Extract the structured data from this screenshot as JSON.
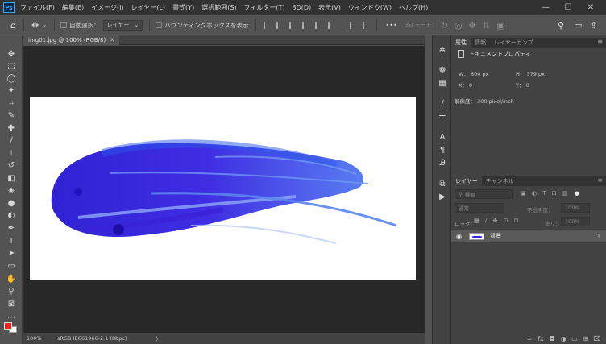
{
  "app": {
    "logo": "Ps"
  },
  "menu": [
    "ファイル(F)",
    "編集(E)",
    "イメージ(I)",
    "レイヤー(L)",
    "書式(Y)",
    "選択範囲(S)",
    "フィルター(T)",
    "3D(D)",
    "表示(V)",
    "ウィンドウ(W)",
    "ヘルプ(H)"
  ],
  "window_controls": {
    "minimize": "—",
    "maximize": "☐",
    "close": "✕"
  },
  "options": {
    "auto_select_label": "自動選択：",
    "auto_select_value": "レイヤー",
    "bounding_box_label": "バウンディングボックスを表示",
    "more": "•••",
    "mode_3d": "3D モード："
  },
  "top_right": {
    "search": "⚲",
    "workspace": "▭",
    "share": "⇪"
  },
  "document": {
    "tab_label": "img01.jpg @ 100% (RGB/8)",
    "tab_close": "✕",
    "zoom": "100%",
    "color_profile": "sRGB IEC61966-2.1 (8bpc)",
    "status_arrow": "〉"
  },
  "colors": {
    "foreground": "#e8261e",
    "background": "#ffffff",
    "stroke": "#2f1be0"
  },
  "tools": [
    "move-icon",
    "marquee-icon",
    "lasso-icon",
    "magic-wand-icon",
    "crop-icon",
    "eyedropper-icon",
    "healing-icon",
    "brush-icon",
    "stamp-icon",
    "history-brush-icon",
    "eraser-icon",
    "bucket-icon",
    "blur-icon",
    "dodge-icon",
    "pen-icon",
    "type-icon",
    "path-select-icon",
    "shape-icon",
    "hand-icon",
    "zoom-icon",
    "frame-icon",
    "more-tools-icon"
  ],
  "properties_panel": {
    "tabs": [
      "属性",
      "情報",
      "レイヤーカンプ"
    ],
    "header": "ドキュメントプロパティ",
    "width_label": "W：",
    "width_value": "800 px",
    "height_label": "H：",
    "height_value": "379 px",
    "x_label": "X：",
    "x_value": "0",
    "y_label": "Y：",
    "y_value": "0",
    "resolution_label": "解像度：",
    "resolution_value": "300 pixel/inch"
  },
  "layers_panel": {
    "tabs": [
      "レイヤー",
      "チャンネル"
    ],
    "filter_kind": "種類",
    "blend_mode": "通常",
    "opacity_label": "不透明度：",
    "opacity_value": "100%",
    "lock_label": "ロック：",
    "fill_label": "塗り：",
    "fill_value": "100%",
    "layers": [
      {
        "name": "背景",
        "visible": true,
        "locked": true
      }
    ]
  }
}
